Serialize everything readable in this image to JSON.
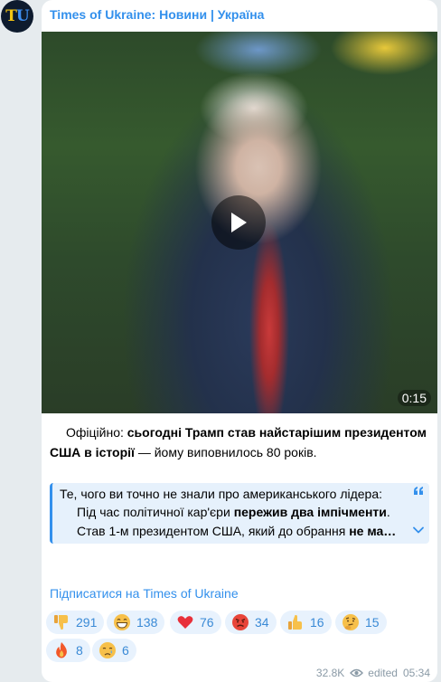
{
  "channel": {
    "avatar_text_t": "T",
    "avatar_text_u": "U",
    "name": "Times of Ukraine: Новини | Україна"
  },
  "video": {
    "duration": "0:15",
    "play_icon": "play-icon"
  },
  "caption": {
    "prefix": "Офіційно: ",
    "bold": "сьогодні Трамп став найстарішим президентом США в історії",
    "suffix": " — йому виповнилось 80 років."
  },
  "quote": {
    "line1": "Те, чого ви точно не знали про американського лідера:",
    "line2_prefix": "Під час політичної кар'єри ",
    "line2_bold": "пережив два імпічменти",
    "line2_suffix": ".",
    "line3_prefix": "Став 1-м президентом США, який до обрання ",
    "line3_bold": "не ма…",
    "quote_icon": "quote-icon",
    "expand_icon": "chevron-down-icon"
  },
  "subscribe_label": "Підписатися на Times of Ukraine",
  "reactions": [
    {
      "emoji": "thumbs-down",
      "count": "291"
    },
    {
      "emoji": "grinning-face",
      "count": "138"
    },
    {
      "emoji": "red-heart",
      "count": "76"
    },
    {
      "emoji": "angry-face",
      "count": "34"
    },
    {
      "emoji": "thumbs-up",
      "count": "16"
    },
    {
      "emoji": "thinking-face",
      "count": "15"
    },
    {
      "emoji": "fire",
      "count": "8"
    },
    {
      "emoji": "crying-face",
      "count": "6"
    }
  ],
  "footer": {
    "views": "32.8K",
    "views_icon": "eye-icon",
    "edited": "edited",
    "time": "05:34"
  },
  "colors": {
    "accent": "#3390ec",
    "background": "#e6ebee",
    "bubble": "#ffffff",
    "quote_bg": "#e6f1fc",
    "reaction_bg": "#e8f2fd"
  }
}
